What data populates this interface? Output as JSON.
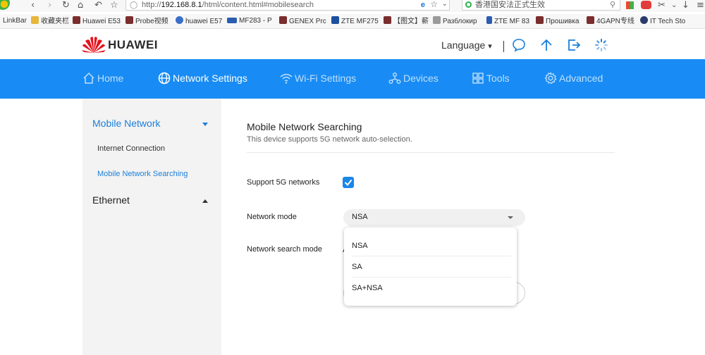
{
  "browser": {
    "url_prefix": "http://",
    "url_host": "192.168.8.1",
    "url_path": "/html/content.html#mobilesearch",
    "search_text": "香港国安法正式生效",
    "bookmarks": [
      "LinkBar",
      "收藏夹栏",
      "Huawei E53",
      "Probe视频",
      "huawei E57",
      "MF283 - P",
      "GENEX Prc",
      "ZTE MF275",
      "【图文】薪",
      "Разблокир",
      "ZTE MF 83",
      "Прошивка",
      "4GAPN专线",
      "IT Tech Sto"
    ]
  },
  "header": {
    "brand": "HUAWEI",
    "language_label": "Language",
    "language_caret": "▾",
    "brand_color": "#e4141d"
  },
  "nav": {
    "color": "#188cf4",
    "items": [
      {
        "label": "Home",
        "icon": "home-icon"
      },
      {
        "label": "Network Settings",
        "icon": "globe-icon"
      },
      {
        "label": "Wi-Fi Settings",
        "icon": "wifi-icon"
      },
      {
        "label": "Devices",
        "icon": "devices-icon"
      },
      {
        "label": "Tools",
        "icon": "tools-icon"
      },
      {
        "label": "Advanced",
        "icon": "gear-icon"
      }
    ],
    "active_index": 1
  },
  "sidebar": {
    "sections": [
      {
        "label": "Mobile Network",
        "expanded": true,
        "items": [
          "Internet Connection",
          "Mobile Network Searching"
        ]
      },
      {
        "label": "Ethernet",
        "expanded": false,
        "items": []
      }
    ],
    "active_item": "Mobile Network Searching"
  },
  "main": {
    "title": "Mobile Network Searching",
    "description": "This device supports 5G network auto-selection.",
    "support_5g_label": "Support 5G networks",
    "support_5g_checked": true,
    "network_mode_label": "Network mode",
    "network_mode_value": "NSA",
    "network_search_mode_label": "Network search mode",
    "network_search_mode_value_partial": "A",
    "dropdown_options": [
      "NSA",
      "SA",
      "SA+NSA"
    ]
  }
}
